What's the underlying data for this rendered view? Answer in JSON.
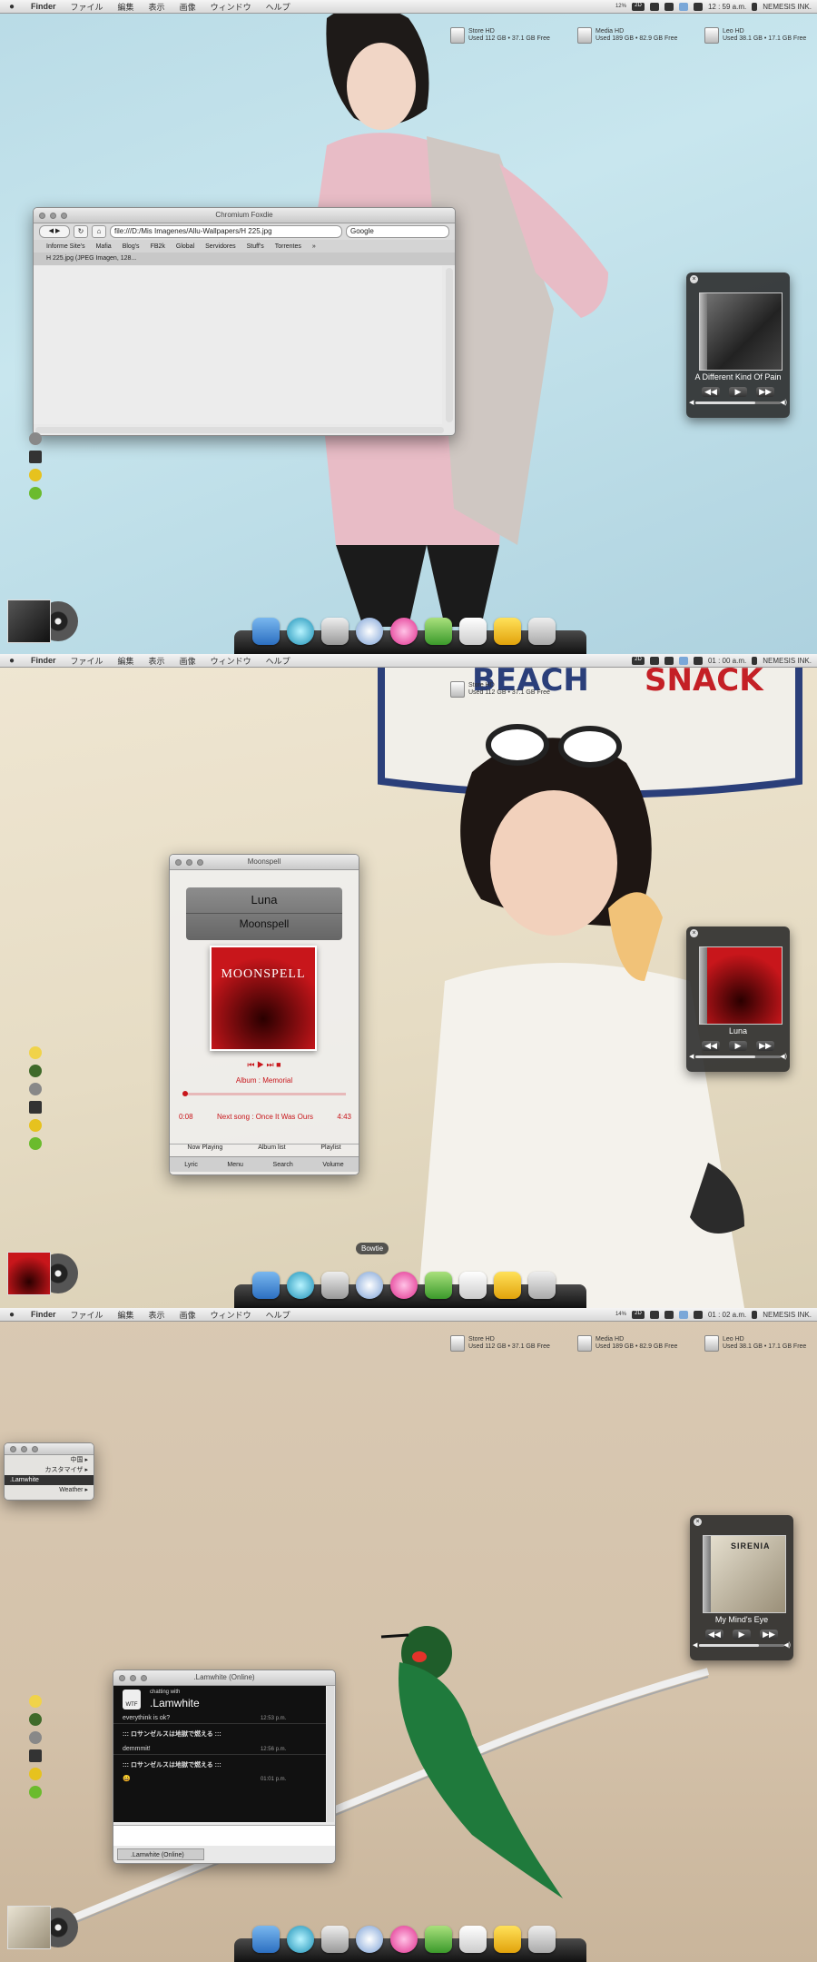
{
  "menubar": {
    "apple": "",
    "items": [
      "Finder",
      "ファイル",
      "編集",
      "表示",
      "画像",
      "ウィンドウ",
      "ヘルプ"
    ],
    "user": "NEMESIS INK.",
    "clock_1": "12 : 59 a.m.",
    "clock_2": "01 : 00 a.m.",
    "clock_3": "01 : 02 a.m.",
    "stat_1": "12%",
    "stat_2": "14%",
    "badge_2d": "2D"
  },
  "drives": {
    "store": {
      "name": "Store HD",
      "info": "Used 112 GB • 37.1 GB Free"
    },
    "media": {
      "name": "Media HD",
      "info": "Used 189 GB • 82.9 GB Free"
    },
    "leo": {
      "name": "Leo HD",
      "info": "Used 38.1 GB • 17.1 GB Free"
    }
  },
  "browser": {
    "title": "Chromium Foxdie",
    "url": "file:///D:/Mis Imagenes/Allu-Wallpapers/H 225.jpg",
    "search": "Google",
    "bookmarks": [
      "Informe Site's",
      "Mafia",
      "Blog's",
      "FB2k",
      "Global",
      "Servidores",
      "Stuff's",
      "Torrentes"
    ],
    "tab": "H 225.jpg (JPEG Imagen, 128...",
    "more": "»"
  },
  "moonspell": {
    "title": "Moonspell",
    "song": "Luna",
    "artist": "Moonspell",
    "album_label": "Album",
    "album": "Memorial",
    "logo": "MOONSPELL",
    "elapsed": "0:08",
    "next_label": "Next song",
    "next_song": "Once It Was Ours",
    "duration": "4:43",
    "transport": "⏮ ▶ ⏭ ■",
    "tabs": [
      "Now Playing",
      "Album list",
      "Playlist"
    ],
    "bottom": [
      "Lyric",
      "Menu",
      "Search",
      "Volume"
    ]
  },
  "players": {
    "p1": {
      "track": "A Different Kind Of Pain"
    },
    "p2": {
      "track": "Luna"
    },
    "p3": {
      "track": "My Mind's Eye",
      "logo": "SIRENIA"
    }
  },
  "player_controls": {
    "prev": "◀◀",
    "play": "▶",
    "next": "▶▶",
    "close": "×",
    "vmin": "◀",
    "vmax": "◀)"
  },
  "tooltip": "Bowtie",
  "menuwidget": {
    "items": [
      "中国",
      "カスタマイザ",
      ".Lamwhite",
      "Weather"
    ],
    "arrow": "▸"
  },
  "chat": {
    "title": ".Lamwhite (Online)",
    "chatting_with": "chatting with",
    "contact": ".Lamwhite",
    "logo": "WTF",
    "messages": [
      {
        "header": "::: ロサンゼルスは地獄で燃える :::",
        "text": "everythink is ok?",
        "time": "12:53 p.m."
      },
      {
        "header": "::: ロサンゼルスは地獄で燃える :::",
        "text": "demmmit!",
        "time": "12:56 p.m."
      },
      {
        "header": "::: ロサンゼルスは地獄で燃える :::",
        "text": "😀",
        "time": "01:01 p.m."
      }
    ],
    "tab": ".Lamwhite (Online)"
  },
  "colors": {
    "moonspell_red": "#c8161b",
    "dock_shelf": "#1a1a1a",
    "mark_red": "#c61b1b"
  }
}
